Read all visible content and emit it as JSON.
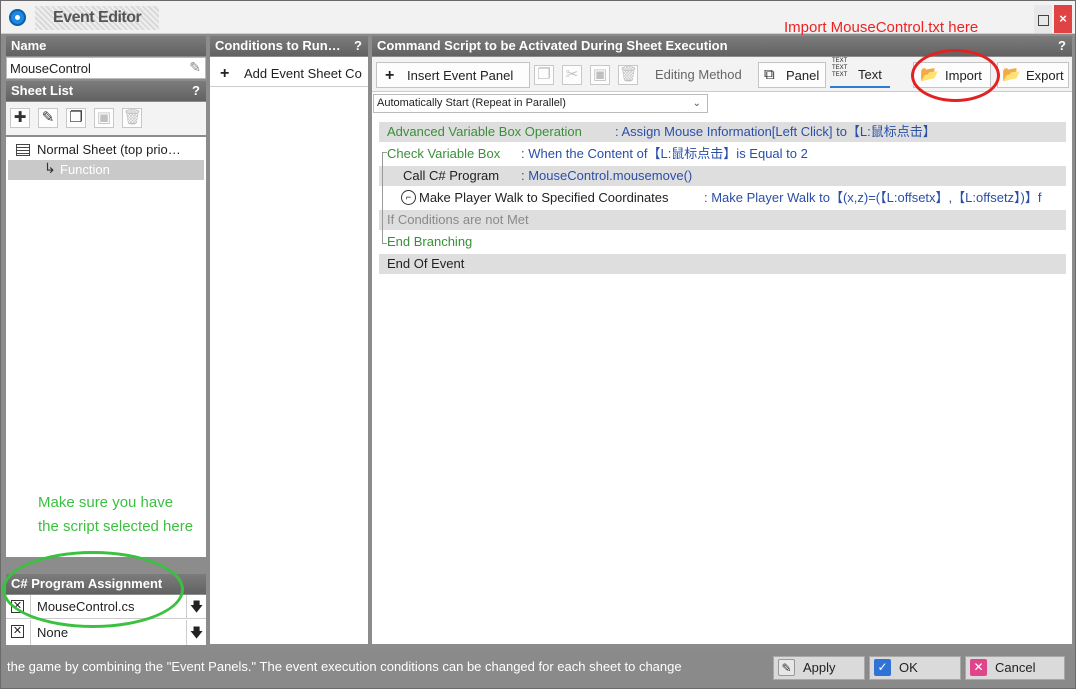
{
  "window": {
    "title": "Event Editor",
    "maximize_glyph": "",
    "close_glyph": "×"
  },
  "left": {
    "name_header": "Name",
    "name_value": "MouseControl",
    "sheet_list_header": "Sheet List",
    "help_glyph": "?",
    "toolbar_icons": [
      "add-icon",
      "edit-icon",
      "copy-icon",
      "paste-icon",
      "delete-icon"
    ],
    "tree": {
      "root": "Normal Sheet (top prio…",
      "child": "Function"
    },
    "csharp_header": "C# Program Assignment",
    "csharp_rows": [
      {
        "value": "MouseControl.cs"
      },
      {
        "value": "None"
      }
    ]
  },
  "conditions": {
    "header": "Conditions to Run…",
    "add_button": "Add Event Sheet Co"
  },
  "command": {
    "header": "Command Script to be Activated During Sheet Execution",
    "toolbar": {
      "insert_panel": "Insert Event Panel",
      "editing_method": "Editing Method",
      "panel": "Panel",
      "text": "Text",
      "import": "Import",
      "export": "Export"
    },
    "trigger_select": "Automatically Start (Repeat in Parallel)",
    "lines": [
      {
        "label": "Advanced Variable Box Operation",
        "detail": ": Assign Mouse Information[Left Click] to【L:鼠标点击】"
      },
      {
        "label": "Check Variable Box",
        "detail": ": When the Content of【L:鼠标点击】is Equal to 2"
      },
      {
        "label": "Call C# Program",
        "detail": ": MouseControl.mousemove()"
      },
      {
        "label": "Make Player Walk to Specified Coordinates",
        "detail": ": Make Player Walk to【(x,z)=(【L:offsetx】,【L:offsetz】)】f"
      },
      {
        "label": "If Conditions are not Met",
        "detail": ""
      },
      {
        "label": "End Branching",
        "detail": ""
      },
      {
        "label": "End Of Event",
        "detail": ""
      }
    ]
  },
  "status_text": "the game by combining the \"Event Panels.\"  The event execution conditions can be changed for each sheet to change",
  "buttons": {
    "apply": "Apply",
    "ok": "OK",
    "cancel": "Cancel"
  },
  "annotations": {
    "import_note": "Import MouseControl.txt here",
    "select_note_line1": "Make sure you have",
    "select_note_line2": "the script selected here"
  },
  "colors": {
    "annotation_red": "#e22222",
    "annotation_green": "#3cc040",
    "panel_header": "#6e6e6e"
  }
}
